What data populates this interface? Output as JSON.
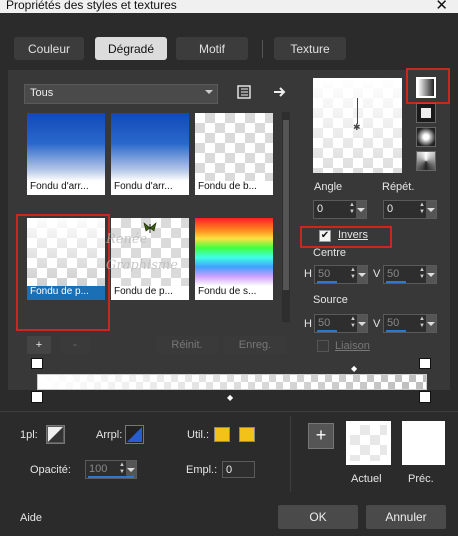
{
  "window": {
    "title": "Propriétés des styles et textures",
    "close_glyph": "✕"
  },
  "tabs": [
    {
      "label": "Couleur",
      "active": false
    },
    {
      "label": "Dégradé",
      "active": true
    },
    {
      "label": "Motif",
      "active": false
    },
    {
      "label": "Texture",
      "active": false
    }
  ],
  "library": {
    "filter_value": "Tous",
    "thumbnails": [
      {
        "caption": "Fondu d'arr...",
        "style": "blue",
        "selected": false
      },
      {
        "caption": "Fondu d'arr...",
        "style": "blue",
        "selected": false
      },
      {
        "caption": "Fondu de b...",
        "style": "checker",
        "selected": false
      },
      {
        "caption": "Fondu de p...",
        "style": "white",
        "selected": true
      },
      {
        "caption": "Fondu de p...",
        "style": "checker-icon",
        "selected": false
      },
      {
        "caption": "Fondu de s...",
        "style": "rainbow",
        "selected": false
      }
    ],
    "watermark_line1": "Renée",
    "watermark_line2": "Graphisme",
    "add_label": "+",
    "remove_label": "-",
    "reset_label": "Réinit.",
    "save_label": "Enreg."
  },
  "gradient_options": {
    "angle_label": "Angle",
    "angle_value": "0",
    "repeat_label": "Répét.",
    "repeat_value": "0",
    "invert_label": "Invers",
    "invert_checked": true,
    "center_label": "Centre",
    "center_h_label": "H",
    "center_h_value": "50",
    "center_v_label": "V",
    "center_v_value": "50",
    "source_label": "Source",
    "source_h_label": "H",
    "source_h_value": "50",
    "source_v_label": "V",
    "source_v_value": "50",
    "link_label": "Liaison",
    "link_checked": false
  },
  "bottom": {
    "layer1_label": "1pl:",
    "arrpl_label": "Arrpl:",
    "util_label": "Util.:",
    "opacity_label": "Opacité:",
    "opacity_value": "100",
    "empl_label": "Empl.:",
    "empl_value": "0",
    "add_symbol": "+",
    "current_label": "Actuel",
    "previous_label": "Préc.",
    "swatch_color": "#f2c21b"
  },
  "footer": {
    "help_label": "Aide",
    "ok_label": "OK",
    "cancel_label": "Annuler"
  },
  "colors": {
    "background": "#2b2b2b",
    "panel": "#383838",
    "highlight_red": "#c8281e",
    "selection_blue": "#1a6fb5",
    "accent_blue": "#2a78d0"
  }
}
